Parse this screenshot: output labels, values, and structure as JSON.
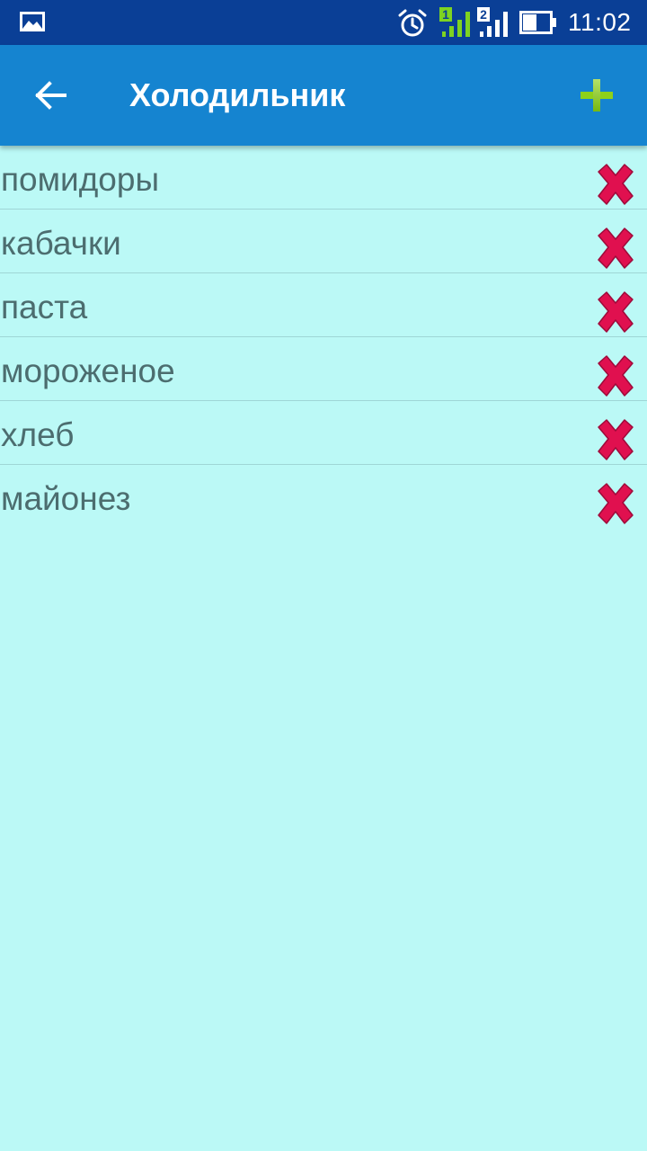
{
  "status_bar": {
    "time": "11:02",
    "icons": [
      "gallery-icon",
      "alarm-icon",
      "sim1-signal-icon",
      "sim2-signal-icon",
      "battery-icon"
    ],
    "sim1_label": "1",
    "sim2_label": "2",
    "sim1_color": "#7ed321",
    "background": "#0a3f96"
  },
  "toolbar": {
    "title": "Холодильник",
    "back_icon": "arrow-left-icon",
    "add_icon": "plus-icon",
    "add_color": "#8ed11a",
    "background": "#1584d0"
  },
  "list": {
    "items": [
      {
        "label": "помидоры"
      },
      {
        "label": "кабачки"
      },
      {
        "label": "паста"
      },
      {
        "label": "мороженое"
      },
      {
        "label": "хлеб"
      },
      {
        "label": "майонез"
      }
    ],
    "delete_icon": "close-icon",
    "delete_color": "#e0104f",
    "text_color": "#4c6d6f"
  },
  "page": {
    "background": "#bbf9f6"
  }
}
